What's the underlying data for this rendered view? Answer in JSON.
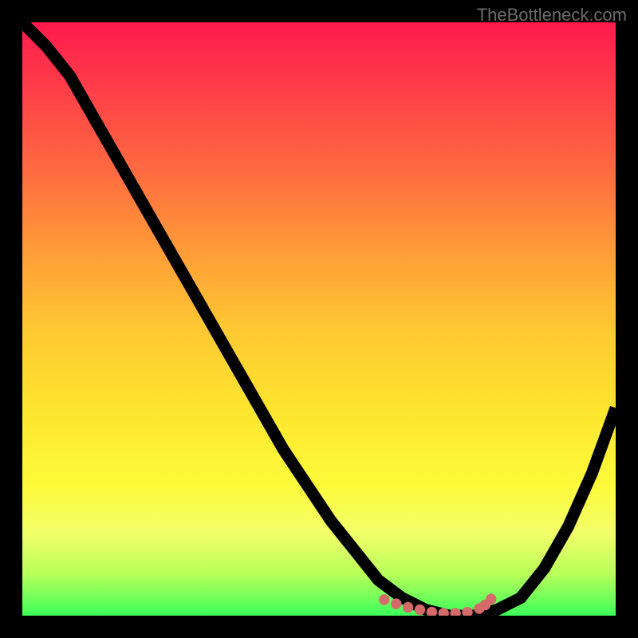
{
  "watermark": "TheBottleneck.com",
  "chart_data": {
    "type": "line",
    "title": "",
    "xlabel": "",
    "ylabel": "",
    "xlim": [
      0,
      100
    ],
    "ylim": [
      0,
      100
    ],
    "series": [
      {
        "name": "bottleneck-curve",
        "x": [
          0,
          4,
          8,
          12,
          16,
          20,
          24,
          28,
          32,
          36,
          40,
          44,
          48,
          52,
          56,
          60,
          64,
          68,
          72,
          76,
          80,
          84,
          88,
          92,
          96,
          100
        ],
        "y": [
          100,
          96,
          91,
          84,
          77,
          70,
          63,
          56,
          49,
          42,
          35,
          28,
          22,
          16,
          11,
          6,
          3,
          1,
          0,
          0,
          1,
          3,
          8,
          15,
          24,
          35
        ]
      }
    ],
    "marker_points": {
      "name": "optimal-range-dots",
      "x": [
        61,
        63,
        65,
        67,
        69,
        71,
        73,
        75,
        77,
        78,
        79
      ],
      "y": [
        2.7,
        2.0,
        1.4,
        1.0,
        0.6,
        0.4,
        0.4,
        0.6,
        1.2,
        1.8,
        2.8
      ]
    },
    "background": {
      "gradient": [
        "#ff1a4d",
        "#ffc932",
        "#fdfb3a",
        "#3dff5a"
      ],
      "direction": "top-to-bottom"
    }
  }
}
